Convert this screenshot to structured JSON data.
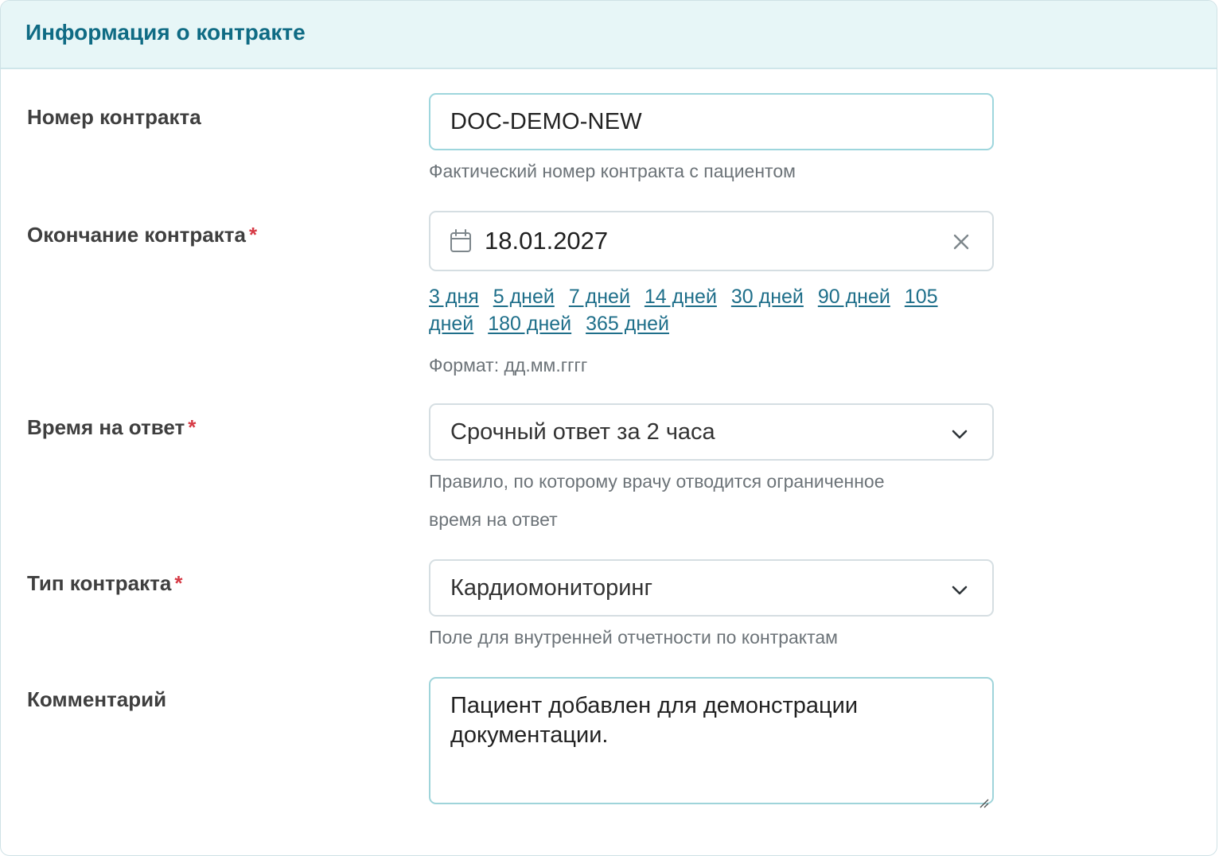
{
  "card": {
    "title": "Информация о контракте"
  },
  "contract_number": {
    "label": "Номер контракта",
    "value": "DOC-DEMO-NEW",
    "hint": "Фактический номер контракта с пациентом"
  },
  "contract_end": {
    "label": "Окончание контракта",
    "required_mark": "*",
    "value": "18.01.2027",
    "quick_links": [
      "3 дня",
      "5 дней",
      "7 дней",
      "14 дней",
      "30 дней",
      "90 дней",
      "105 дней",
      "180 дней",
      "365 дней"
    ],
    "hint": "Формат: дд.мм.гггг"
  },
  "response_time": {
    "label": "Время на ответ",
    "required_mark": "*",
    "value": "Срочный ответ за 2 часа",
    "hint_line1": "Правило, по которому врачу отводится ограниченное",
    "hint_line2": "время на ответ"
  },
  "contract_type": {
    "label": "Тип контракта",
    "required_mark": "*",
    "value": "Кардиомониторинг",
    "hint": "Поле для внутренней отчетности по контрактам"
  },
  "comment": {
    "label": "Комментарий",
    "value_line1": "Пациент добавлен для демонстрации",
    "value_line2": "документации."
  },
  "icons": {
    "date": "calendar-icon",
    "clear": "close-icon",
    "select": "chevron-down-icon",
    "resize": "resize-grip-icon"
  },
  "colors": {
    "header_bg": "#e7f6f7",
    "title": "#0f6b84",
    "link": "#1f6f8a",
    "required": "#d63a45",
    "focus_border": "#9ed6dd"
  }
}
